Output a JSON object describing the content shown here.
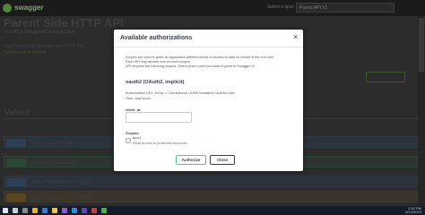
{
  "topbar": {
    "brand": "swagger",
    "spec_label": "Select a spec",
    "spec_value": "Parent API V1"
  },
  "page": {
    "title": "Parent Side HTTP API",
    "version": "V1 OAS3 /swagger/v1/swagger.json",
    "description": "The Parent Side Microservice HTTP API",
    "contact": "Send email to Pakma",
    "authorize_label": "Authorize",
    "section_title": "Values"
  },
  "operations": [
    {
      "method": "GET",
      "path": "/api/v1/Values"
    },
    {
      "method": "POST",
      "path": "/api/v1/Values"
    },
    {
      "method": "GET",
      "path": "/api/v1/Values/{id}"
    },
    {
      "method": "PUT",
      "path": "/api/v1/Values/{id}"
    }
  ],
  "modal": {
    "title": "Available authorizations",
    "close_symbol": "×",
    "intro_lines": [
      "Scopes are used to grant an application different levels of access to data on behalf of the end user.",
      "Each API may declare one or more scopes.",
      "API requires the following scopes. Select which ones you want to grant to Swagger UI."
    ],
    "scheme_title": "oauth2 (OAuth2, implicit)",
    "authorization_url_label": "Authorization URL:",
    "authorization_url": "http://localhost:5105/connect/authorize",
    "flow_label": "Flow:",
    "flow_value": "implicit",
    "client_id_label": "client_id:",
    "client_id_value": "",
    "scopes_label": "Scopes:",
    "scope_name": "api1",
    "scope_description": "Read access to protected resources",
    "authorize_button": "Authorize",
    "close_button": "Close"
  },
  "taskbar": {
    "time": "2:52 PM",
    "date": "6/12/2019"
  },
  "colors": {
    "get": "#61affe",
    "post": "#49cc90",
    "put": "#fca130",
    "authorize_border": "#49cc90"
  }
}
